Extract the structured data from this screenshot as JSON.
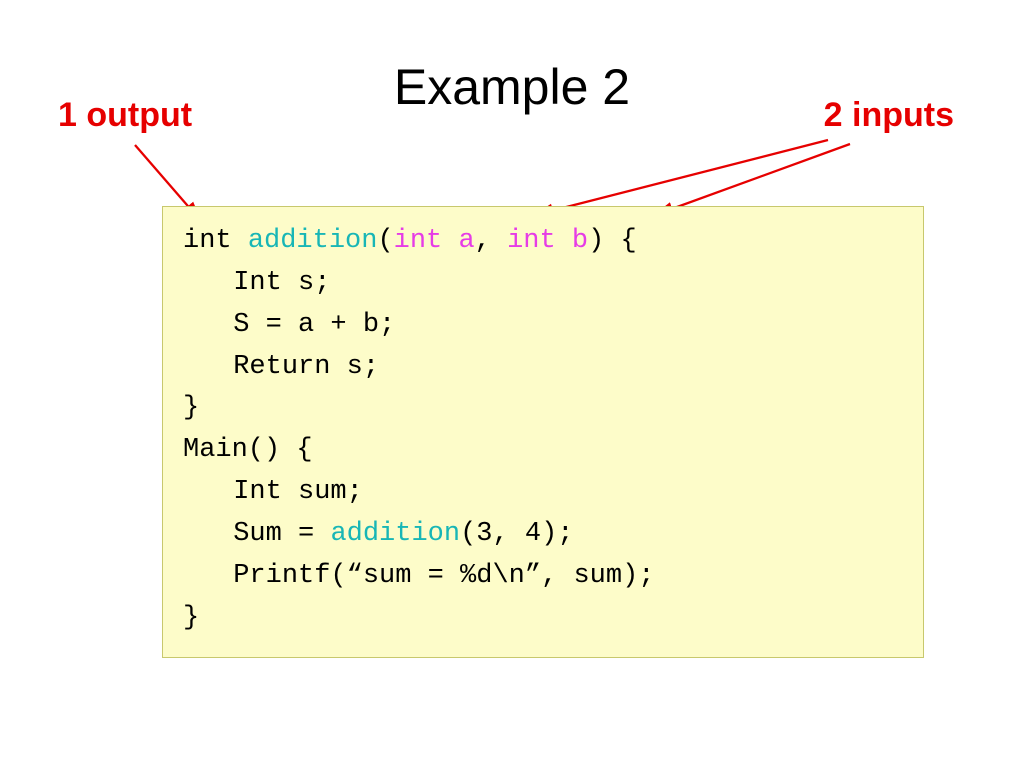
{
  "title": "Example 2",
  "labels": {
    "left": "1 output",
    "right": "2 inputs"
  },
  "code": {
    "l1": {
      "kw": "int",
      "fn": "addition",
      "p1": "int a",
      "sep": ",",
      "p2": "int b",
      "tail": ") {"
    },
    "l2": "Int s;",
    "l3": "S = a + b;",
    "l4": "Return s;",
    "l5": "}",
    "l6": "Main() {",
    "l7": "Int sum;",
    "l8": {
      "pre": "Sum = ",
      "fn": "addition",
      "post": "(3, 4);"
    },
    "l9": "Printf(“sum = %d\\n”, sum);",
    "l10": "}"
  },
  "colors": {
    "label": "#e60000",
    "fn": "#18b6b6",
    "param": "#e63ce6",
    "codeBg": "#fdfcc9"
  }
}
